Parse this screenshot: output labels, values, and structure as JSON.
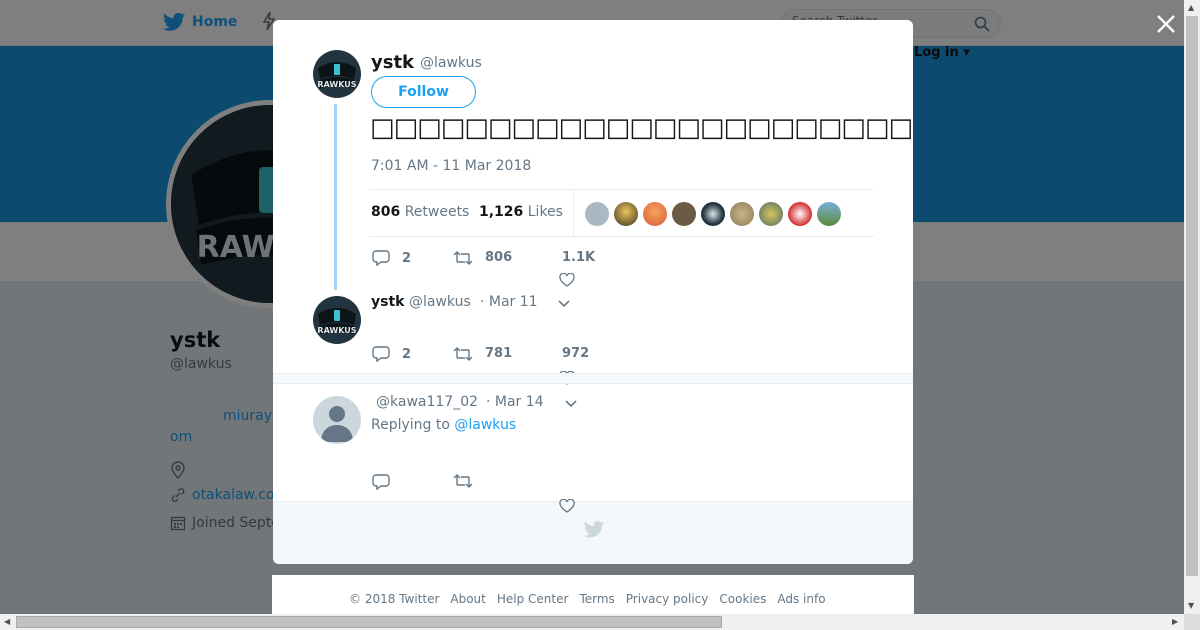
{
  "topbar": {
    "home_label": "Home",
    "moments_label": "M",
    "search_placeholder": "Search Twitter",
    "login_label": "Log in ▾"
  },
  "profile": {
    "name": "ystk",
    "handle": "@lawkus",
    "bio_link_1": "miuray",
    "bio_link_2": "om",
    "website": "otakalaw.co",
    "joined": "Joined Septe"
  },
  "modal": {
    "author_name": "ystk",
    "author_handle": "@lawkus",
    "follow_label": "Follow",
    "tweet_text": "□□□□□□□□□□□□□□□□□□□□□□□□□□□□□□□□□□□□□□□□□□□□□",
    "timestamp": "7:01 AM - 11 Mar 2018",
    "retweets_count": "806",
    "retweets_label": "Retweets",
    "likes_count": "1,126",
    "likes_label": "Likes",
    "actions": {
      "replies": "2",
      "retweets": "806",
      "likes": "1.1K"
    },
    "reply1": {
      "name": "ystk",
      "handle": "@lawkus",
      "date": "· Mar 11",
      "replies": "2",
      "retweets": "781",
      "likes": "972"
    },
    "reply2": {
      "handle": "@kawa117_02",
      "date": "· Mar 14",
      "replying_prefix": "Replying to",
      "replying_handle": "@lawkus"
    }
  },
  "footer": {
    "links": [
      "© 2018 Twitter",
      "About",
      "Help Center",
      "Terms",
      "Privacy policy",
      "Cookies",
      "Ads info"
    ]
  },
  "colors": {
    "brand": "#1da1f2",
    "banner": "#1b95e0",
    "text_secondary": "#657786"
  },
  "icons": [
    "twitter-bird-icon",
    "moments-icon",
    "search-icon",
    "close-icon",
    "reply-icon",
    "retweet-icon",
    "heart-icon",
    "chevron-down-icon",
    "location-icon",
    "link-icon",
    "calendar-icon"
  ]
}
